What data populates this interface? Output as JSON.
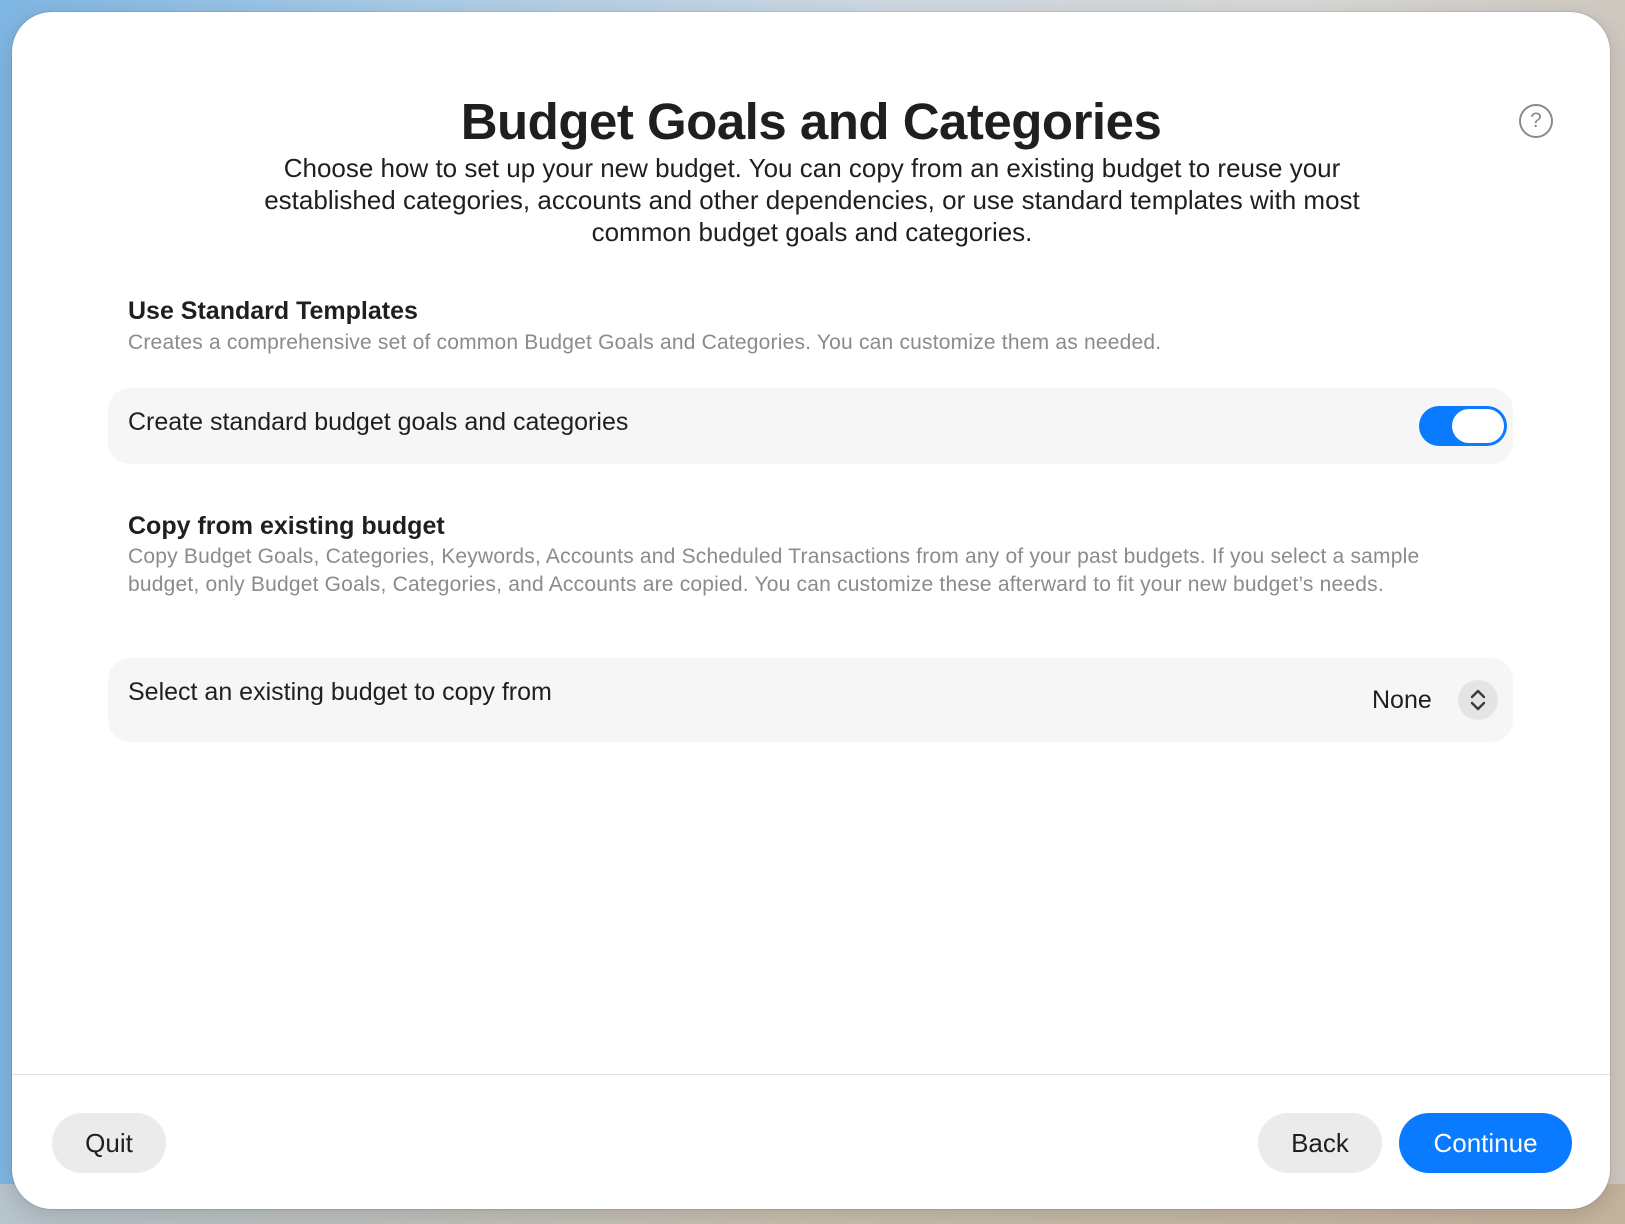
{
  "header": {
    "title": "Budget Goals and Categories",
    "subtitle": "Choose how to set up your new budget. You can copy from an existing budget to reuse your established categories, accounts and other dependencies, or use standard templates with most common budget goals and categories.",
    "help_icon": "question-mark-circle-icon",
    "help_glyph": "?"
  },
  "standard_templates": {
    "heading": "Use Standard Templates",
    "description": "Creates a comprehensive set of common Budget Goals and Categories. You can customize them as needed.",
    "toggle_label": "Create standard budget goals and categories",
    "toggle_on": true
  },
  "copy_existing": {
    "heading": "Copy from existing budget",
    "description": "Copy Budget Goals, Categories, Keywords, Accounts and Scheduled Transactions from any of your past budgets. If you select a sample budget, only Budget Goals, Categories, and Accounts are copied. You can customize these afterward to fit your new budget’s needs.",
    "select_label": "Select an existing budget to copy from",
    "select_value": "None"
  },
  "footer": {
    "quit_label": "Quit",
    "back_label": "Back",
    "continue_label": "Continue"
  },
  "colors": {
    "accent": "#0a7aff",
    "secondary_text": "#8b8b8b"
  }
}
